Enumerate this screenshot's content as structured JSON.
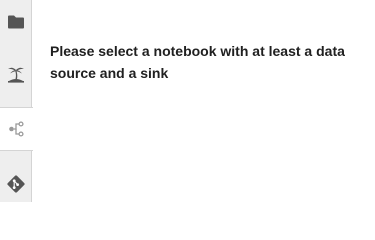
{
  "sidebar": {
    "items": [
      {
        "icon": "folder-icon",
        "active": false
      },
      {
        "icon": "island-icon",
        "active": false
      },
      {
        "icon": "pipeline-icon",
        "active": true
      },
      {
        "icon": "git-icon",
        "active": false
      }
    ]
  },
  "main": {
    "message": "Please select a notebook with at least a data source and a sink"
  },
  "colors": {
    "icon": "#555555",
    "icon_active": "#9a9a9a",
    "sidebar_bg": "#eeeeee",
    "text": "#202020"
  }
}
